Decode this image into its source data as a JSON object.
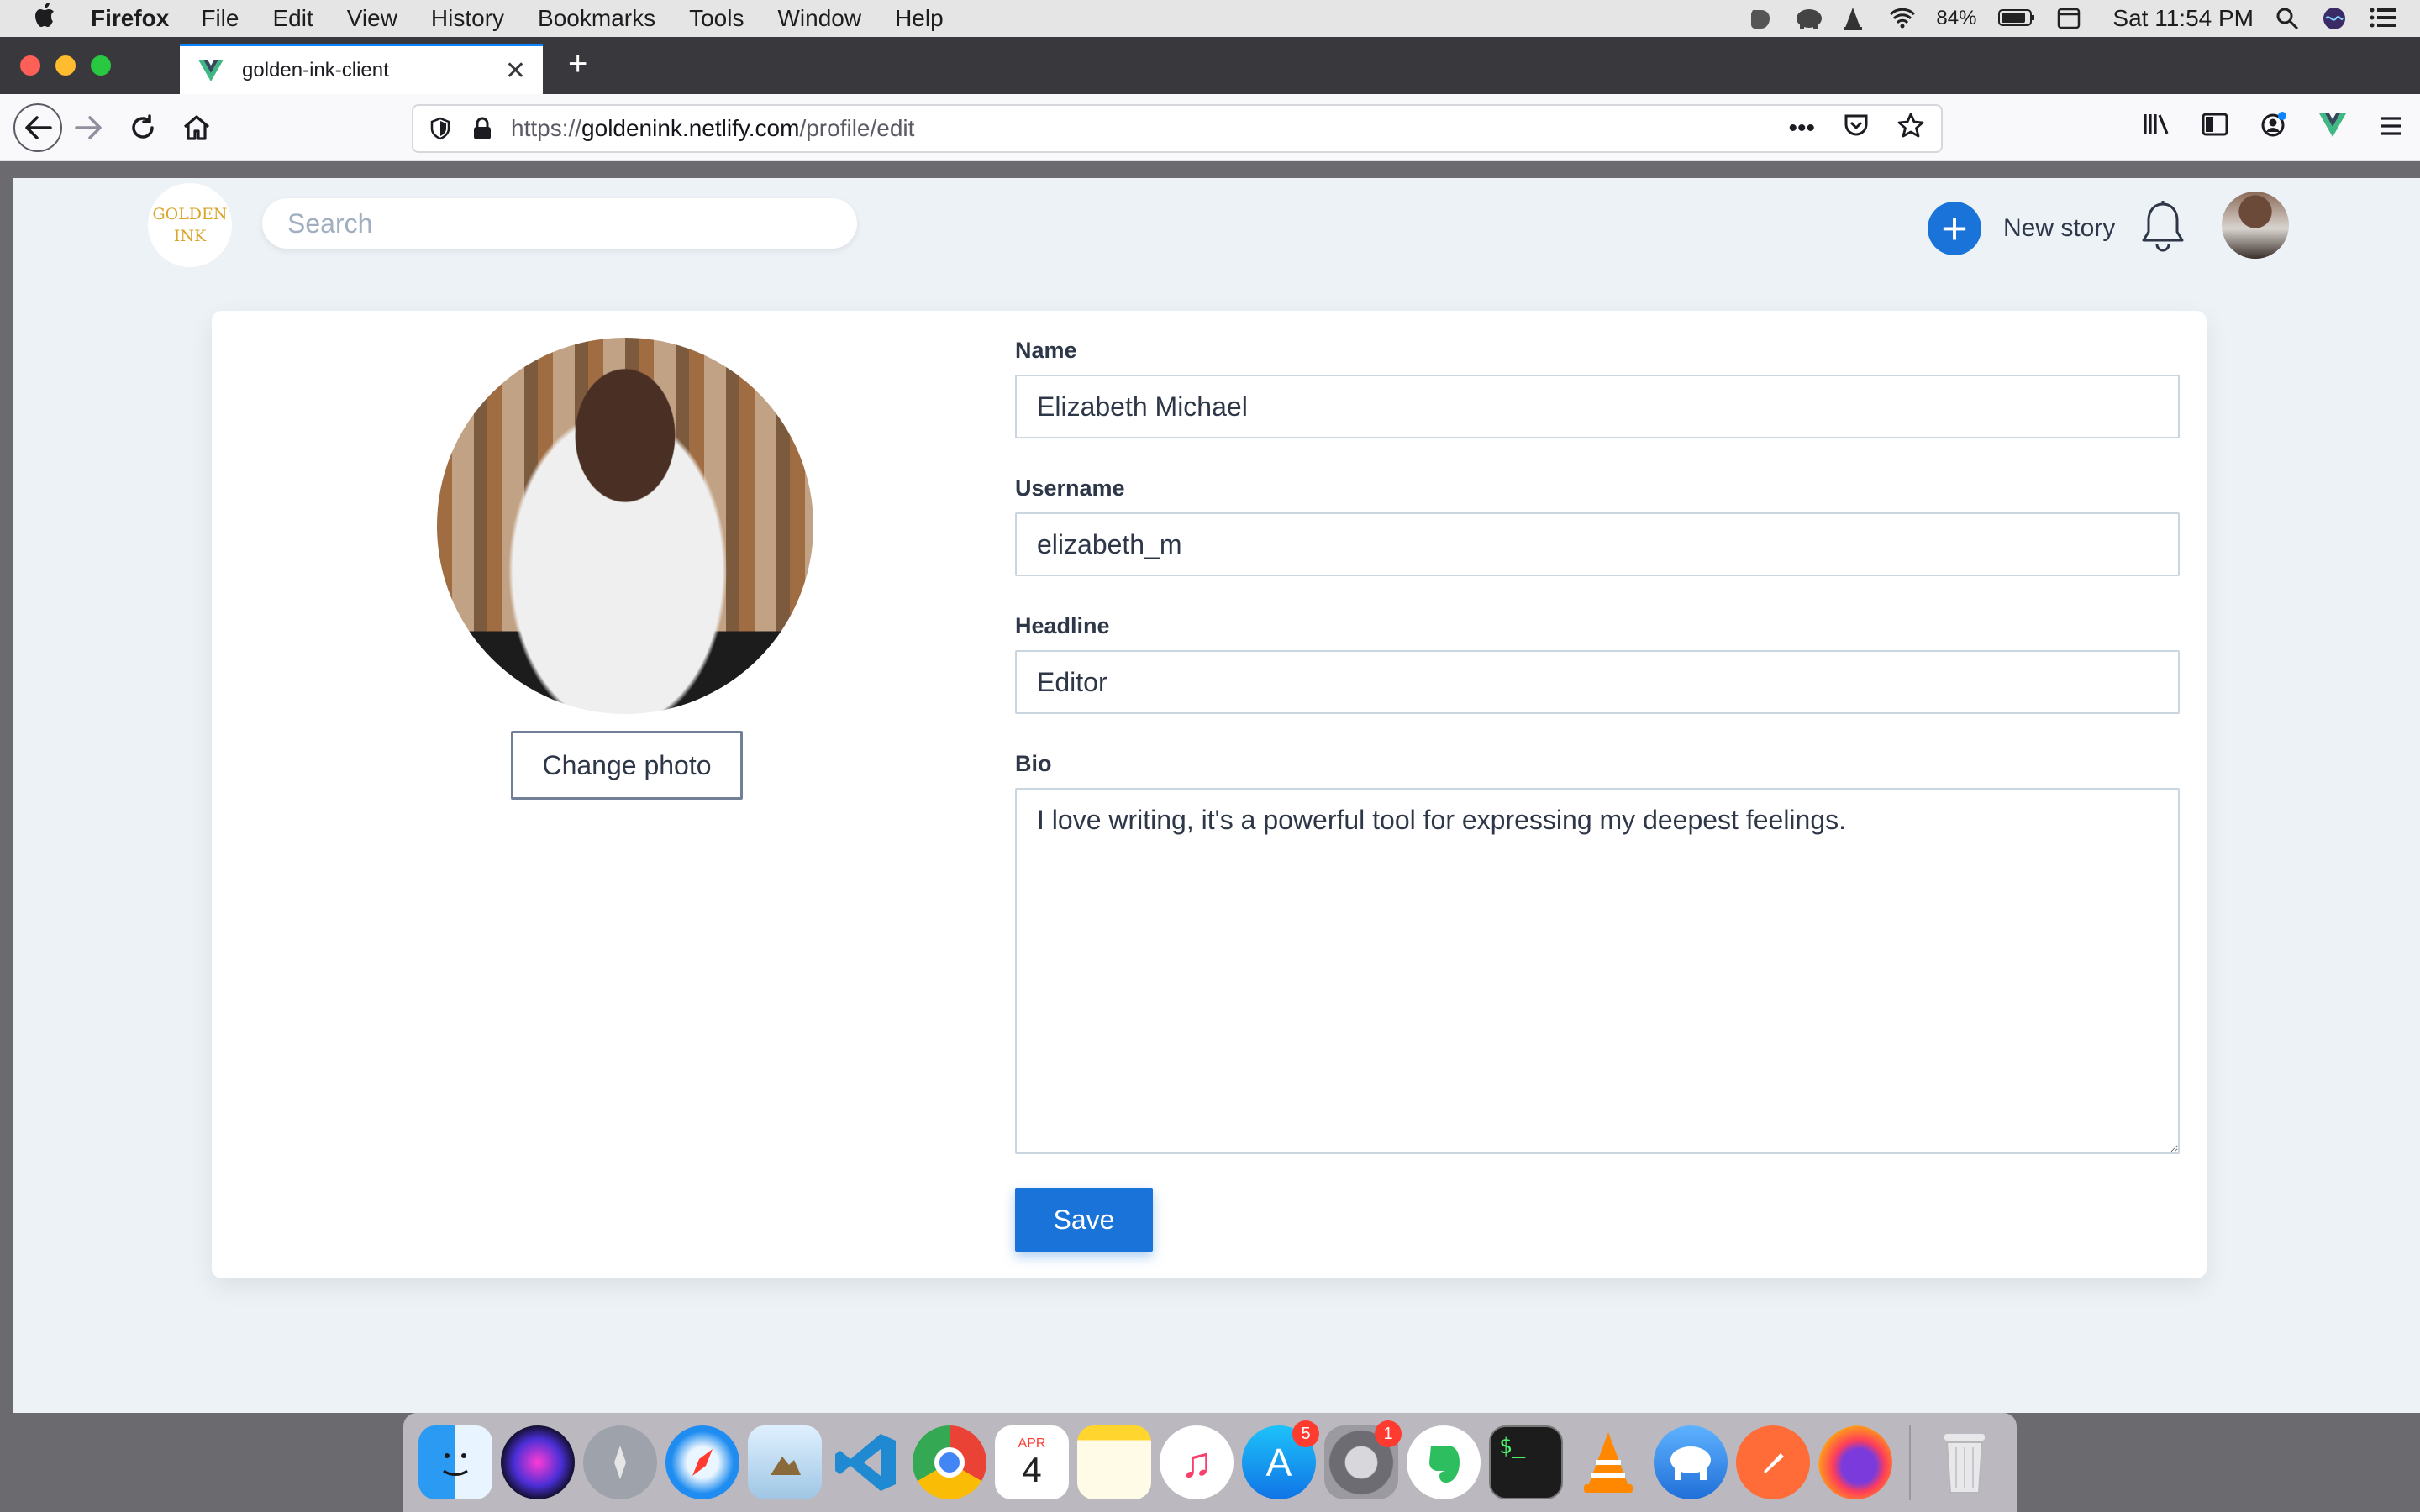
{
  "menubar": {
    "app_name": "Firefox",
    "items": [
      "File",
      "Edit",
      "View",
      "History",
      "Bookmarks",
      "Tools",
      "Window",
      "Help"
    ],
    "battery": "84%",
    "clock": "Sat 11:54 PM"
  },
  "browser": {
    "tab_title": "golden-ink-client",
    "url_prefix": "https://",
    "url_domain": "goldenink.netlify.com",
    "url_path": "/profile/edit"
  },
  "header": {
    "logo_line1": "GOLDEN",
    "logo_line2": "INK",
    "search_placeholder": "Search",
    "new_story_label": "New story"
  },
  "profile": {
    "change_photo_label": "Change photo",
    "fields": {
      "name_label": "Name",
      "name_value": "Elizabeth Michael",
      "username_label": "Username",
      "username_value": "elizabeth_m",
      "headline_label": "Headline",
      "headline_value": "Editor",
      "bio_label": "Bio",
      "bio_value": "I love writing, it's a powerful tool for expressing my deepest feelings."
    },
    "save_label": "Save"
  },
  "dock": {
    "calendar_month": "APR",
    "calendar_day": "4",
    "app_store_badge": "5",
    "system_prefs_badge": "1"
  },
  "colors": {
    "primary": "#1a73d9",
    "page_bg": "#edf2f7",
    "logo_gold": "#d9a52b"
  }
}
